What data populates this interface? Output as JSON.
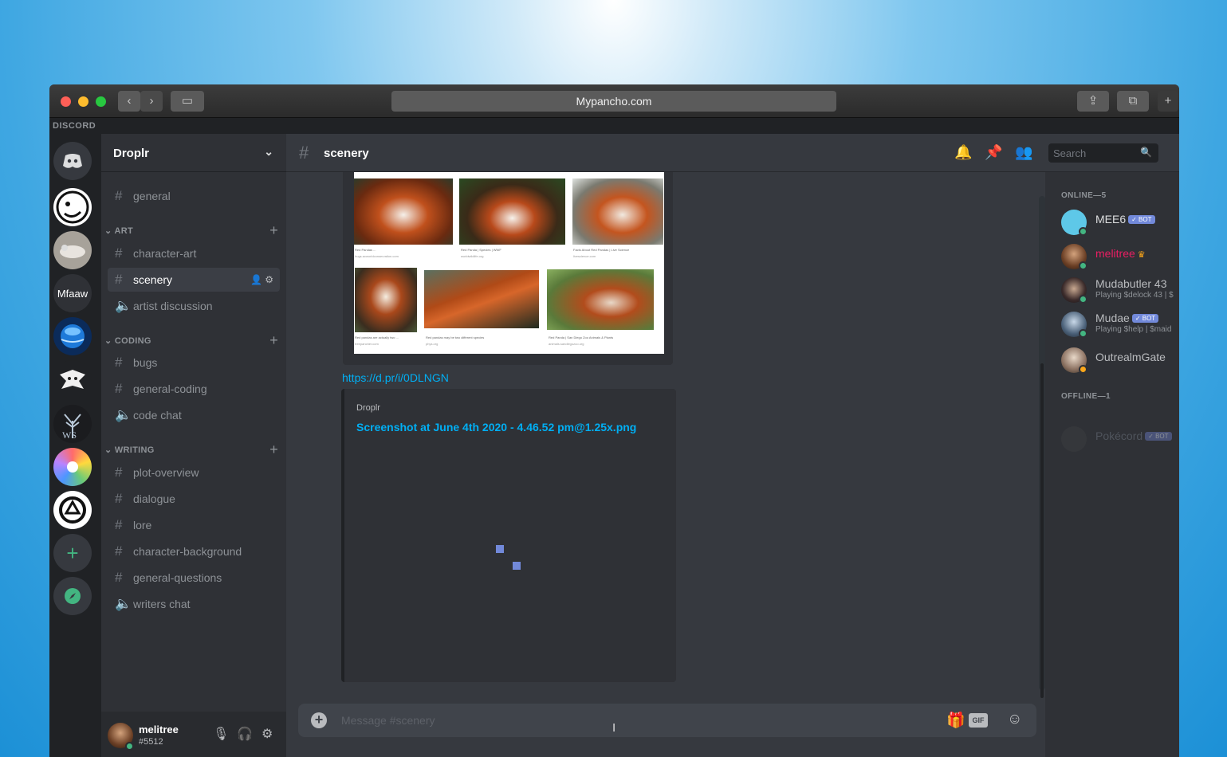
{
  "browser": {
    "url": "Mypancho.com",
    "back_icon": "chevron-left",
    "forward_icon": "chevron-right",
    "new_tab_label": "+"
  },
  "app": {
    "brand": "DISCORD"
  },
  "servers": [
    {
      "name": "home",
      "label": ""
    },
    {
      "name": "server-1",
      "label": ""
    },
    {
      "name": "server-2",
      "label": ""
    },
    {
      "name": "server-mfaaw",
      "label": "Mfaaw"
    },
    {
      "name": "server-4",
      "label": ""
    },
    {
      "name": "server-5",
      "label": ""
    },
    {
      "name": "server-ws",
      "label": "WS"
    },
    {
      "name": "server-7",
      "label": ""
    },
    {
      "name": "server-8",
      "label": ""
    },
    {
      "name": "add-server",
      "label": "+"
    },
    {
      "name": "explore",
      "label": ""
    }
  ],
  "guild": {
    "name": "Droplr",
    "channels": {
      "general": "general",
      "art_category": "ART",
      "character_art": "character-art",
      "scenery": "scenery",
      "artist_discussion": "artist discussion",
      "coding_category": "CODING",
      "bugs": "bugs",
      "general_coding": "general-coding",
      "code_chat": "code chat",
      "writing_category": "WRITING",
      "plot_overview": "plot-overview",
      "dialogue": "dialogue",
      "lore": "lore",
      "character_background": "character-background",
      "general_questions": "general-questions",
      "writers_chat": "writers chat"
    }
  },
  "user": {
    "name": "melitree",
    "tag": "#5512"
  },
  "chat": {
    "channel_name": "scenery",
    "search_placeholder": "Search",
    "link": "https://d.pr/i/0DLNGN",
    "embed_provider": "Droplr",
    "embed_title": "Screenshot at June 4th 2020 - 4.46.52 pm@1.25x.png",
    "image_captions": [
      [
        "Red Pandas ...",
        "hugs.acworldconservation.com"
      ],
      [
        "Red Panda | Species | WWF",
        "worldwildlife.org"
      ],
      [
        "Facts About Red Pandas | Live Science",
        "livescience.com"
      ],
      [
        "Red pandas are actually two ...",
        "treepancher.com"
      ],
      [
        "Red pandas may be two different species",
        "phys.org"
      ],
      [
        "Red Panda | San Diego Zoo Animals & Plants",
        "animals.sandiegozoo.org"
      ]
    ],
    "composer_placeholder": "Message #scenery",
    "gif_label": "GIF"
  },
  "members": {
    "online_header": "ONLINE—5",
    "offline_header": "OFFLINE—1",
    "bot_label": "✓ BOT",
    "list": [
      {
        "name": "MEE6",
        "bot": true,
        "activity": "",
        "color": "#dcddde",
        "status": "#43b581"
      },
      {
        "name": "melitree",
        "bot": false,
        "activity": "",
        "color": "#e91e63",
        "status": "#43b581"
      },
      {
        "name": "Mudabutler 43",
        "bot": false,
        "activity": "Playing $delock 43 | $",
        "color": "#b9bbbe",
        "status": "#43b581"
      },
      {
        "name": "Mudae",
        "bot": true,
        "activity": "Playing $help | $maid",
        "color": "#b9bbbe",
        "status": "#43b581"
      },
      {
        "name": "OutrealmGate",
        "bot": false,
        "activity": "",
        "color": "#b9bbbe",
        "status": "#faa61a"
      },
      {
        "name": "Pokécord",
        "bot": true,
        "activity": "",
        "color": "#4f545c",
        "status": ""
      }
    ]
  },
  "colors": {
    "accent": "#7289da",
    "link": "#00aff4",
    "online": "#43b581"
  }
}
